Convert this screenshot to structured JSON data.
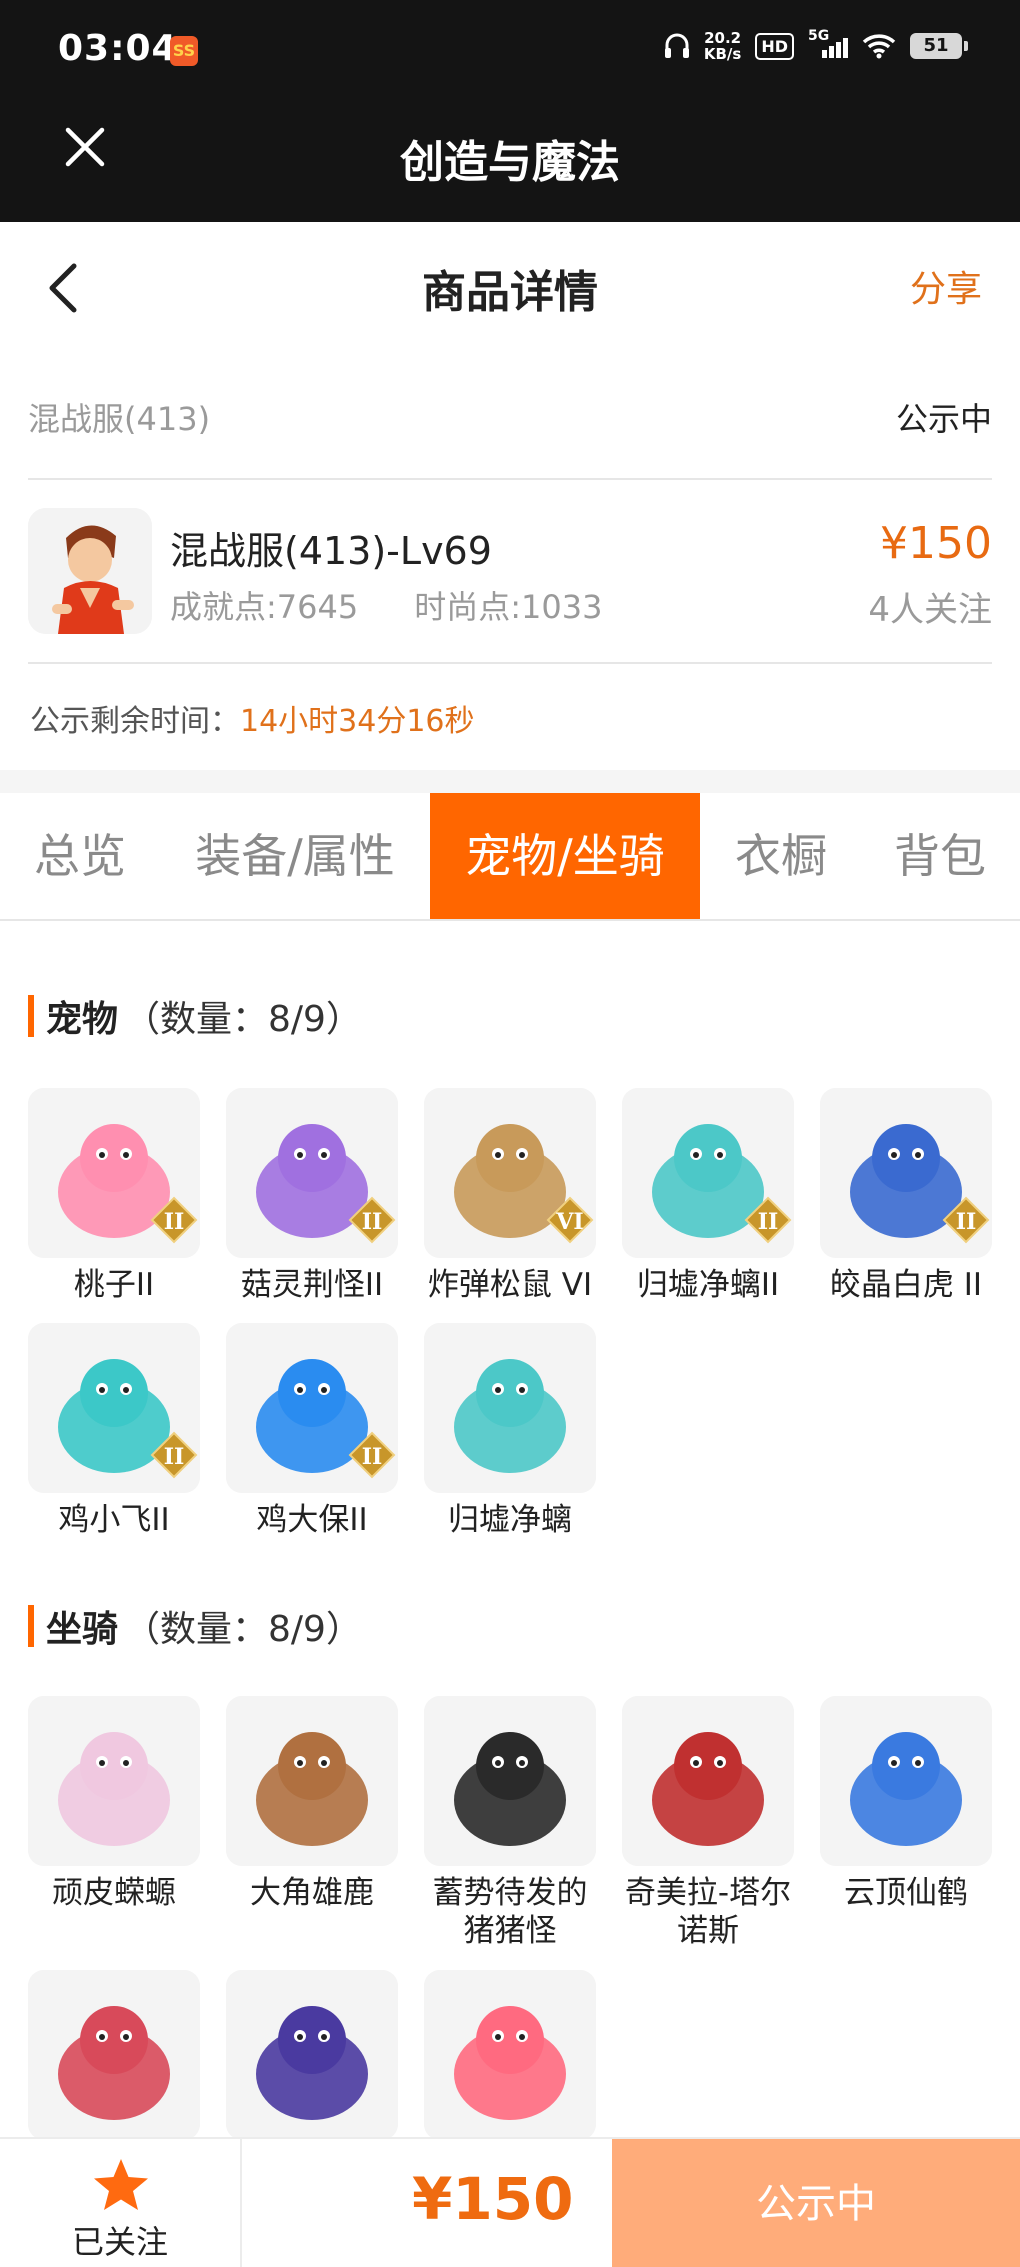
{
  "status_bar": {
    "time": "03:04",
    "app_badge": "SS",
    "net_speed_value": "20.2",
    "net_speed_unit": "KB/s",
    "hd_label": "HD",
    "signal_label": "5G",
    "battery": "51"
  },
  "app_bar": {
    "title": "创造与魔法"
  },
  "header": {
    "title": "商品详情",
    "share_label": "分享"
  },
  "server": {
    "name": "混战服(413)",
    "status": "公示中"
  },
  "item": {
    "title": "混战服(413)-Lv69",
    "achievement": "成就点:7645",
    "fashion": "时尚点:1033",
    "price": "¥150",
    "followers": "4人关注"
  },
  "countdown": {
    "label": "公示剩余时间：",
    "value": "14小时34分16秒"
  },
  "tabs": [
    {
      "label": "总览"
    },
    {
      "label": "装备/属性"
    },
    {
      "label": "宠物/坐骑"
    },
    {
      "label": "衣橱"
    },
    {
      "label": "背包"
    }
  ],
  "active_tab": "宠物/坐骑",
  "pets": {
    "title": "宠物",
    "count": "（数量：8/9）",
    "items": [
      {
        "name": "桃子II",
        "badge": "II",
        "color": "#ff8fb0"
      },
      {
        "name": "菇灵荆怪II",
        "badge": "II",
        "color": "#a070e0"
      },
      {
        "name": "炸弹松鼠 VI",
        "badge": "VI",
        "color": "#c89a5a"
      },
      {
        "name": "归墟净螭II",
        "badge": "II",
        "color": "#4cc8c8"
      },
      {
        "name": "皎晶白虎 II",
        "badge": "II",
        "color": "#3a6ad0"
      },
      {
        "name": "鸡小飞II",
        "badge": "II",
        "color": "#3cc8c8"
      },
      {
        "name": "鸡大保II",
        "badge": "II",
        "color": "#2a8cf0"
      },
      {
        "name": "归墟净螭",
        "badge": "",
        "color": "#4cc8c8"
      }
    ]
  },
  "mounts": {
    "title": "坐骑",
    "count": "（数量：8/9）",
    "items": [
      {
        "name": "顽皮蝾螈",
        "color": "#f0c8e0"
      },
      {
        "name": "大角雄鹿",
        "color": "#b07040"
      },
      {
        "name": "蓄势待发的猪猪怪",
        "color": "#2a2a2a"
      },
      {
        "name": "奇美拉-塔尔诺斯",
        "color": "#c03030"
      },
      {
        "name": "云顶仙鹤",
        "color": "#3a7ae0"
      },
      {
        "name": "",
        "color": "#d84a5a"
      },
      {
        "name": "",
        "color": "#4a3aa0"
      },
      {
        "name": "",
        "color": "#ff6a80"
      }
    ]
  },
  "bottom": {
    "follow_label": "已关注",
    "price": "¥150",
    "status": "公示中"
  }
}
